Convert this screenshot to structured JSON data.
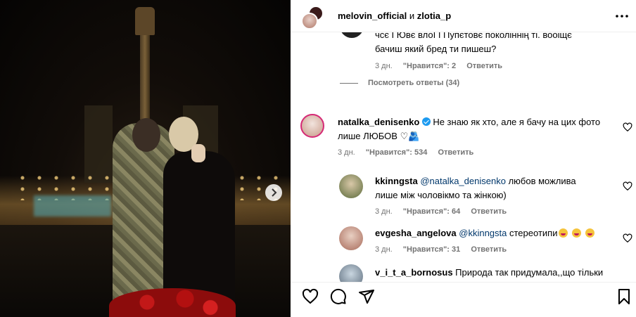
{
  "post": {
    "header": {
      "user1": "melovin_official",
      "and": "и",
      "user2": "zlotia_p"
    }
  },
  "comments": {
    "partial": {
      "line1": "чсє I Ювє влоІ I Пупєтовє поколіннің ті. вооіщє",
      "line2": "бачиш який бред ти пишеш?",
      "time": "3 дн.",
      "likes": "\"Нравится\": 2",
      "reply": "Ответить"
    },
    "view_replies": "Посмотреть ответы (34)",
    "main": {
      "user": "natalka_denisenko",
      "text_line1": "Не знаю як хто, але я бачу на цих фото",
      "text_line2": "лише ЛЮБОВ ♡🫂",
      "time": "3 дн.",
      "likes": "\"Нравится\": 534",
      "reply": "Ответить"
    },
    "replies": [
      {
        "user": "kkinngsta",
        "mention": "@natalka_denisenko",
        "text_line1": "любов можлива",
        "text_line2": "лише між чоловікмо та жінкою)",
        "time": "3 дн.",
        "likes": "\"Нравится\": 64",
        "reply": "Ответить"
      },
      {
        "user": "evgesha_angelova",
        "mention": "@kkinngsta",
        "text": "стереотипи",
        "time": "3 дн.",
        "likes": "\"Нравится\": 31",
        "reply": "Ответить"
      },
      {
        "user": "v_i_t_a_bornosus",
        "text": "Природа так придумала,,що тільки"
      }
    ]
  },
  "colors": {
    "verified": "#1d9bf0",
    "meta": "#737373",
    "mention": "#00376b"
  }
}
